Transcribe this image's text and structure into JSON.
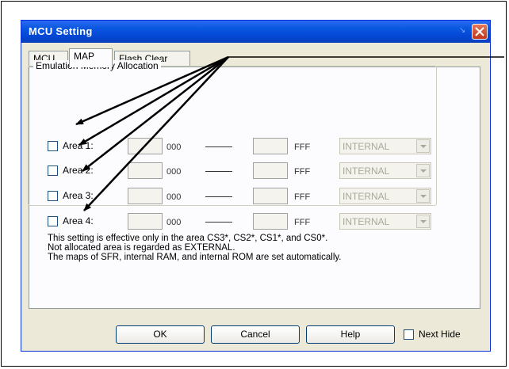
{
  "dialog": {
    "title": "MCU Setting"
  },
  "tabs": [
    {
      "label": "MCU"
    },
    {
      "label": "MAP"
    },
    {
      "label": "Flash Clear"
    }
  ],
  "group": {
    "label": "Emulation Memory Allocation"
  },
  "areas": [
    {
      "label": "Area 1:",
      "start_value": "",
      "start_suffix": "000",
      "end_value": "",
      "end_suffix": "FFF",
      "type": "INTERNAL"
    },
    {
      "label": "Area 2:",
      "start_value": "",
      "start_suffix": "000",
      "end_value": "",
      "end_suffix": "FFF",
      "type": "INTERNAL"
    },
    {
      "label": "Area 3:",
      "start_value": "",
      "start_suffix": "000",
      "end_value": "",
      "end_suffix": "FFF",
      "type": "INTERNAL"
    },
    {
      "label": "Area 4:",
      "start_value": "",
      "start_suffix": "000",
      "end_value": "",
      "end_suffix": "FFF",
      "type": "INTERNAL"
    }
  ],
  "notes": [
    "This setting is effective only in the area CS3*, CS2*, CS1*, and CS0*.",
    "Not allocated area is regarded as EXTERNAL.",
    "The maps of SFR, internal RAM, and internal ROM are set automatically."
  ],
  "buttons": {
    "ok": "OK",
    "cancel": "Cancel",
    "help": "Help",
    "next_hide": "Next Hide"
  },
  "colors": {
    "titlebar": "#0347d4",
    "dialog_bg": "#ece9d8",
    "close": "#c2341a",
    "callout": "#000000"
  }
}
